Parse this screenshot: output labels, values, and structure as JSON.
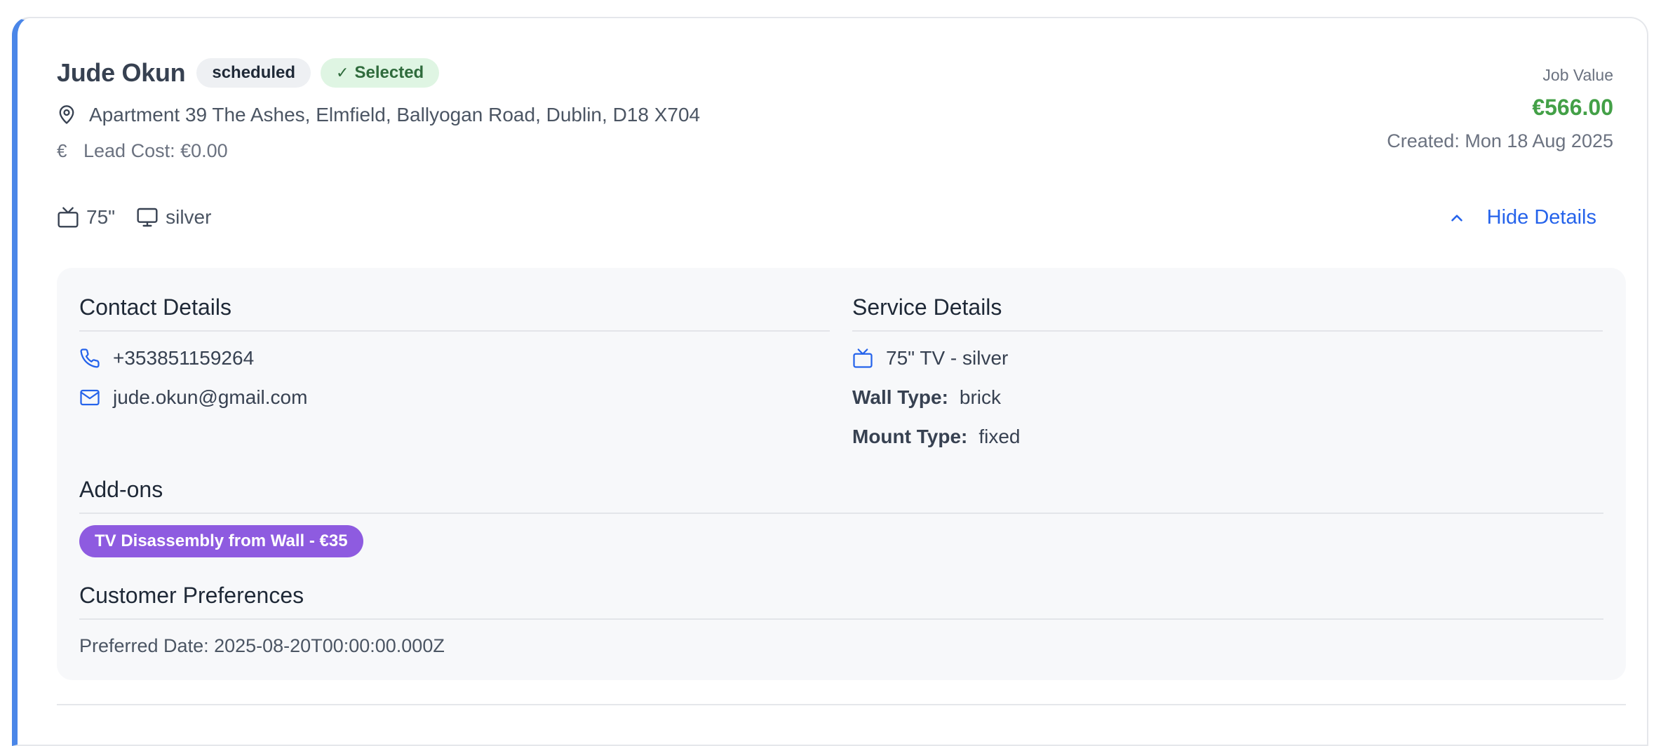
{
  "job": {
    "name": "Jude Okun",
    "status": "scheduled",
    "selected_label": "Selected",
    "address": "Apartment 39 The Ashes, Elmfield, Ballyogan Road, Dublin, D18 X704",
    "lead_cost": "Lead Cost: €0.00",
    "job_value_label": "Job Value",
    "job_value": "€566.00",
    "created": "Created: Mon 18 Aug 2025",
    "tv_size": "75\"",
    "tv_color": "silver",
    "toggle_label": "Hide Details"
  },
  "contact": {
    "title": "Contact Details",
    "phone": "+353851159264",
    "email": "jude.okun@gmail.com"
  },
  "service": {
    "title": "Service Details",
    "tv": "75\" TV - silver",
    "wall_type_label": "Wall Type:",
    "wall_type": "brick",
    "mount_type_label": "Mount Type:",
    "mount_type": "fixed"
  },
  "addons": {
    "title": "Add-ons",
    "items": [
      "TV Disassembly from Wall - €35"
    ]
  },
  "preferences": {
    "title": "Customer Preferences",
    "preferred_date": "Preferred Date: 2025-08-20T00:00:00.000Z"
  },
  "colors": {
    "accent": "#4a86e8",
    "link": "#2563eb",
    "value_green": "#43a047",
    "addon_purple": "#8e5be0",
    "selected_bg": "#dff5e3"
  },
  "icons": {
    "address": "map-pin-icon",
    "lead_cost": "euro-icon",
    "tv_size": "tv-icon",
    "tv_color": "monitor-icon",
    "toggle": "chevron-up-icon",
    "phone": "phone-icon",
    "email": "mail-icon",
    "service_tv": "tv-icon",
    "selected": "check-icon"
  }
}
